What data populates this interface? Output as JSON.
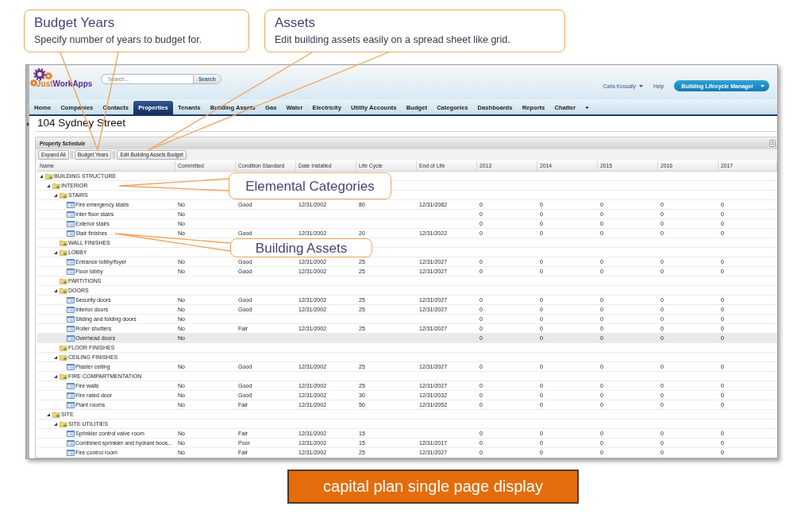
{
  "annotations": {
    "header_callouts": [
      {
        "title": "Budget Years",
        "text": "Specify number of years to budget for."
      },
      {
        "title": "Assets",
        "text": "Edit building assets easily on a spread sheet like grid."
      }
    ],
    "grid_callouts": [
      {
        "title": "Elemental Categories"
      },
      {
        "title": "Building Assets"
      }
    ]
  },
  "header": {
    "logo_text": [
      "Just",
      "WorkApps"
    ],
    "search": {
      "placeholder": "Search...",
      "button": "Search"
    },
    "user_menu": "Carla Kossally",
    "help": "Help",
    "app_menu": "Building Lifecycle Manager"
  },
  "tabs": [
    {
      "label": "Home",
      "selected": false
    },
    {
      "label": "Companies",
      "selected": false
    },
    {
      "label": "Contacts",
      "selected": false
    },
    {
      "label": "Properties",
      "selected": true
    },
    {
      "label": "Tenants",
      "selected": false
    },
    {
      "label": "Building Assets",
      "selected": false
    },
    {
      "label": "Gas",
      "selected": false
    },
    {
      "label": "Water",
      "selected": false
    },
    {
      "label": "Electricity",
      "selected": false
    },
    {
      "label": "Utility Accounts",
      "selected": false
    },
    {
      "label": "Budget",
      "selected": false
    },
    {
      "label": "Categories",
      "selected": false
    },
    {
      "label": "Dashboards",
      "selected": false
    },
    {
      "label": "Reports",
      "selected": false
    },
    {
      "label": "Chatter",
      "selected": false
    },
    {
      "label": "+",
      "selected": false
    }
  ],
  "page_title": "104 Sydney Street",
  "property_schedule": {
    "title": "Property Schedule",
    "toolbar": [
      "Expand All",
      "Budget Years",
      "Edit Building Assets Budget"
    ],
    "columns": [
      "Name",
      "Committed",
      "Condition Standard",
      "Date Installed",
      "Life Cycle",
      "End of Life",
      "2013",
      "2014",
      "2015",
      "2016",
      "2017"
    ],
    "rows": [
      {
        "kind": "category",
        "name": "BUILDING STRUCTURE",
        "expanded": true,
        "selected": false,
        "children": [
          {
            "kind": "category",
            "name": "INTERIOR",
            "expanded": true,
            "selected": false,
            "children": [
              {
                "kind": "category",
                "name": "STAIRS",
                "expanded": true,
                "selected": false,
                "children": [
                  {
                    "kind": "asset",
                    "name": "Fire emergency stairs",
                    "selected": false,
                    "committed": "No",
                    "condition": "Good",
                    "installed": "12/31/2002",
                    "life_cycle": "80",
                    "end_of_life": "12/31/2082",
                    "years": [
                      "0",
                      "0",
                      "0",
                      "0",
                      "0"
                    ]
                  },
                  {
                    "kind": "asset",
                    "name": "Inter floor stairs",
                    "selected": false,
                    "committed": "No",
                    "years": [
                      "0",
                      "0",
                      "0",
                      "0",
                      "0"
                    ]
                  },
                  {
                    "kind": "asset",
                    "name": "Exterior stairs",
                    "selected": false,
                    "committed": "No",
                    "years": [
                      "0",
                      "0",
                      "0",
                      "0",
                      "0"
                    ]
                  },
                  {
                    "kind": "asset",
                    "name": "Stair finishes",
                    "selected": false,
                    "committed": "No",
                    "condition": "Good",
                    "installed": "12/31/2002",
                    "life_cycle": "20",
                    "end_of_life": "12/31/2022",
                    "years": [
                      "0",
                      "0",
                      "0",
                      "0",
                      "0"
                    ]
                  }
                ]
              },
              {
                "kind": "category",
                "name": "WALL FINISHES",
                "selected": false
              },
              {
                "kind": "category",
                "name": "LOBBY",
                "expanded": true,
                "selected": false,
                "children": [
                  {
                    "kind": "asset",
                    "name": "Entrance lobby/foyer",
                    "selected": false,
                    "committed": "No",
                    "condition": "Good",
                    "installed": "12/31/2002",
                    "life_cycle": "25",
                    "end_of_life": "12/31/2027",
                    "years": [
                      "0",
                      "0",
                      "0",
                      "0",
                      "0"
                    ]
                  },
                  {
                    "kind": "asset",
                    "name": "Floor lobby",
                    "selected": false,
                    "committed": "No",
                    "condition": "Good",
                    "installed": "12/31/2002",
                    "life_cycle": "25",
                    "end_of_life": "12/31/2027",
                    "years": [
                      "0",
                      "0",
                      "0",
                      "0",
                      "0"
                    ]
                  }
                ]
              },
              {
                "kind": "category",
                "name": "PARTITIONS",
                "selected": false
              },
              {
                "kind": "category",
                "name": "DOORS",
                "expanded": true,
                "selected": false,
                "children": [
                  {
                    "kind": "asset",
                    "name": "Security doors",
                    "selected": false,
                    "committed": "No",
                    "condition": "Good",
                    "installed": "12/31/2002",
                    "life_cycle": "25",
                    "end_of_life": "12/31/2027",
                    "years": [
                      "0",
                      "0",
                      "0",
                      "0",
                      "0"
                    ]
                  },
                  {
                    "kind": "asset",
                    "name": "Interior doors",
                    "selected": false,
                    "committed": "No",
                    "condition": "Good",
                    "installed": "12/31/2002",
                    "life_cycle": "25",
                    "end_of_life": "12/31/2027",
                    "years": [
                      "0",
                      "0",
                      "0",
                      "0",
                      "0"
                    ]
                  },
                  {
                    "kind": "asset",
                    "name": "Sliding and folding doors",
                    "selected": false,
                    "committed": "No",
                    "years": [
                      "0",
                      "0",
                      "0",
                      "0",
                      "0"
                    ]
                  },
                  {
                    "kind": "asset",
                    "name": "Roller shutters",
                    "selected": false,
                    "committed": "No",
                    "condition": "Fair",
                    "installed": "12/31/2002",
                    "life_cycle": "25",
                    "end_of_life": "12/31/2027",
                    "years": [
                      "0",
                      "0",
                      "0",
                      "0",
                      "0"
                    ]
                  },
                  {
                    "kind": "asset",
                    "name": "Overhead doors",
                    "selected": true,
                    "committed": "No",
                    "years": [
                      "0",
                      "0",
                      "0",
                      "0",
                      "0"
                    ]
                  }
                ]
              },
              {
                "kind": "category",
                "name": "FLOOR FINISHES",
                "selected": false
              },
              {
                "kind": "category",
                "name": "CEILING FINISHES",
                "expanded": true,
                "selected": false,
                "children": [
                  {
                    "kind": "asset",
                    "name": "Plaster ceiling",
                    "selected": false,
                    "committed": "No",
                    "condition": "Good",
                    "installed": "12/31/2002",
                    "life_cycle": "25",
                    "end_of_life": "12/31/2027",
                    "years": [
                      "0",
                      "0",
                      "0",
                      "0",
                      "0"
                    ]
                  }
                ]
              },
              {
                "kind": "category",
                "name": "FIRE COMPARTMENTATION",
                "expanded": true,
                "selected": false,
                "children": [
                  {
                    "kind": "asset",
                    "name": "Fire walls",
                    "selected": false,
                    "committed": "No",
                    "condition": "Good",
                    "installed": "12/31/2002",
                    "life_cycle": "25",
                    "end_of_life": "12/31/2027",
                    "years": [
                      "0",
                      "0",
                      "0",
                      "0",
                      "0"
                    ]
                  },
                  {
                    "kind": "asset",
                    "name": "Fire rated door",
                    "selected": false,
                    "committed": "No",
                    "condition": "Good",
                    "installed": "12/31/2002",
                    "life_cycle": "30",
                    "end_of_life": "12/31/2032",
                    "years": [
                      "0",
                      "0",
                      "0",
                      "0",
                      "0"
                    ]
                  },
                  {
                    "kind": "asset",
                    "name": "Plant rooms",
                    "selected": false,
                    "committed": "No",
                    "condition": "Fair",
                    "installed": "12/31/2002",
                    "life_cycle": "50",
                    "end_of_life": "12/31/2052",
                    "years": [
                      "0",
                      "0",
                      "0",
                      "0",
                      "0"
                    ]
                  }
                ]
              }
            ]
          },
          {
            "kind": "category",
            "name": "SITE",
            "expanded": true,
            "selected": false,
            "children": [
              {
                "kind": "category",
                "name": "SITE UTILITIES",
                "expanded": true,
                "selected": false,
                "children": [
                  {
                    "kind": "asset",
                    "name": "Sprinkler control valve room",
                    "selected": false,
                    "committed": "No",
                    "condition": "Fair",
                    "installed": "12/31/2002",
                    "life_cycle": "15",
                    "years": [
                      "0",
                      "0",
                      "0",
                      "0",
                      "0"
                    ]
                  },
                  {
                    "kind": "asset",
                    "name": "Combined sprinkler and hydrant boos...",
                    "selected": false,
                    "committed": "No",
                    "condition": "Poor",
                    "installed": "12/31/2002",
                    "life_cycle": "15",
                    "end_of_life": "12/31/2017",
                    "years": [
                      "0",
                      "0",
                      "0",
                      "0",
                      "0"
                    ]
                  },
                  {
                    "kind": "asset",
                    "name": "Fire control room",
                    "selected": false,
                    "committed": "No",
                    "condition": "Fair",
                    "installed": "12/31/2002",
                    "life_cycle": "25",
                    "end_of_life": "12/31/2027",
                    "years": [
                      "0",
                      "0",
                      "0",
                      "0",
                      "0"
                    ]
                  }
                ]
              }
            ]
          }
        ]
      }
    ]
  },
  "caption": "capital plan single page display"
}
